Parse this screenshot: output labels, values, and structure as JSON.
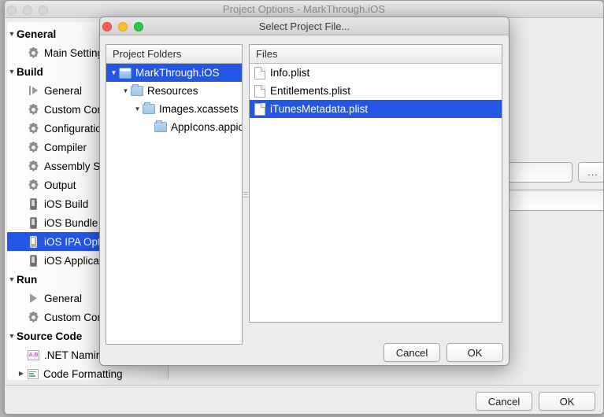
{
  "background_window": {
    "title": "Project Options - MarkThrough.iOS",
    "traffic_lights": [
      "close-inactive",
      "minimize-inactive",
      "zoom-inactive"
    ],
    "sidebar": {
      "items": [
        {
          "label": "General",
          "icon": "group-header",
          "level": 0,
          "expanded": true,
          "selected": false
        },
        {
          "label": "Main Settings",
          "icon": "gear-icon",
          "level": 1,
          "expanded": null,
          "selected": false
        },
        {
          "label": "Build",
          "icon": "group-header",
          "level": 0,
          "expanded": true,
          "selected": false
        },
        {
          "label": "General",
          "icon": "bar-play-icon",
          "level": 1,
          "expanded": null,
          "selected": false
        },
        {
          "label": "Custom Commands",
          "icon": "gear-icon",
          "level": 1,
          "expanded": null,
          "selected": false
        },
        {
          "label": "Configurations",
          "icon": "gear-icon",
          "level": 1,
          "expanded": null,
          "selected": false
        },
        {
          "label": "Compiler",
          "icon": "gear-icon",
          "level": 1,
          "expanded": null,
          "selected": false
        },
        {
          "label": "Assembly Signing",
          "icon": "gear-icon",
          "level": 1,
          "expanded": null,
          "selected": false
        },
        {
          "label": "Output",
          "icon": "gear-icon",
          "level": 1,
          "expanded": null,
          "selected": false
        },
        {
          "label": "iOS Build",
          "icon": "device-icon",
          "level": 1,
          "expanded": null,
          "selected": false
        },
        {
          "label": "iOS Bundle Signing",
          "icon": "device-icon",
          "level": 1,
          "expanded": null,
          "selected": false
        },
        {
          "label": "iOS IPA Options",
          "icon": "device-icon",
          "level": 1,
          "expanded": null,
          "selected": true
        },
        {
          "label": "iOS Application",
          "icon": "device-icon",
          "level": 1,
          "expanded": null,
          "selected": false
        },
        {
          "label": "Run",
          "icon": "group-header",
          "level": 0,
          "expanded": true,
          "selected": false
        },
        {
          "label": "General",
          "icon": "play-icon",
          "level": 1,
          "expanded": null,
          "selected": false
        },
        {
          "label": "Custom Commands",
          "icon": "gear-icon",
          "level": 1,
          "expanded": null,
          "selected": false
        },
        {
          "label": "Source Code",
          "icon": "group-header",
          "level": 0,
          "expanded": true,
          "selected": false
        },
        {
          "label": ".NET Naming Policies",
          "icon": "ab-icon",
          "level": 1,
          "expanded": null,
          "selected": false
        },
        {
          "label": "Code Formatting",
          "icon": "code-format-icon",
          "level": 1,
          "expanded": false,
          "selected": false
        }
      ]
    },
    "footer": {
      "cancel_label": "Cancel",
      "ok_label": "OK"
    },
    "content": {
      "browse_button_label": "..."
    }
  },
  "dialog": {
    "title": "Select Project File...",
    "traffic_lights": [
      "close",
      "minimize",
      "zoom"
    ],
    "tree_panel": {
      "header": "Project Folders",
      "items": [
        {
          "label": "MarkThrough.iOS",
          "icon": "project-icon",
          "level": 0,
          "expanded": true,
          "selected": true
        },
        {
          "label": "Resources",
          "icon": "folder-icon",
          "level": 1,
          "expanded": true,
          "selected": false
        },
        {
          "label": "Images.xcassets",
          "icon": "folder-icon",
          "level": 2,
          "expanded": true,
          "selected": false
        },
        {
          "label": "AppIcons.appiconset",
          "icon": "folder-icon",
          "level": 3,
          "expanded": null,
          "selected": false
        }
      ]
    },
    "files_panel": {
      "header": "Files",
      "items": [
        {
          "label": "Info.plist",
          "icon": "file-icon",
          "selected": false
        },
        {
          "label": "Entitlements.plist",
          "icon": "file-icon",
          "selected": false
        },
        {
          "label": "iTunesMetadata.plist",
          "icon": "file-icon",
          "selected": true
        }
      ]
    },
    "footer": {
      "cancel_label": "Cancel",
      "ok_label": "OK"
    }
  },
  "colors": {
    "selection_blue": "#2457e6",
    "window_chrome": "#ececec",
    "panel_white": "#ffffff",
    "traffic_red": "#ff5f57",
    "traffic_yellow": "#ffbd2e",
    "traffic_green": "#28c840"
  }
}
